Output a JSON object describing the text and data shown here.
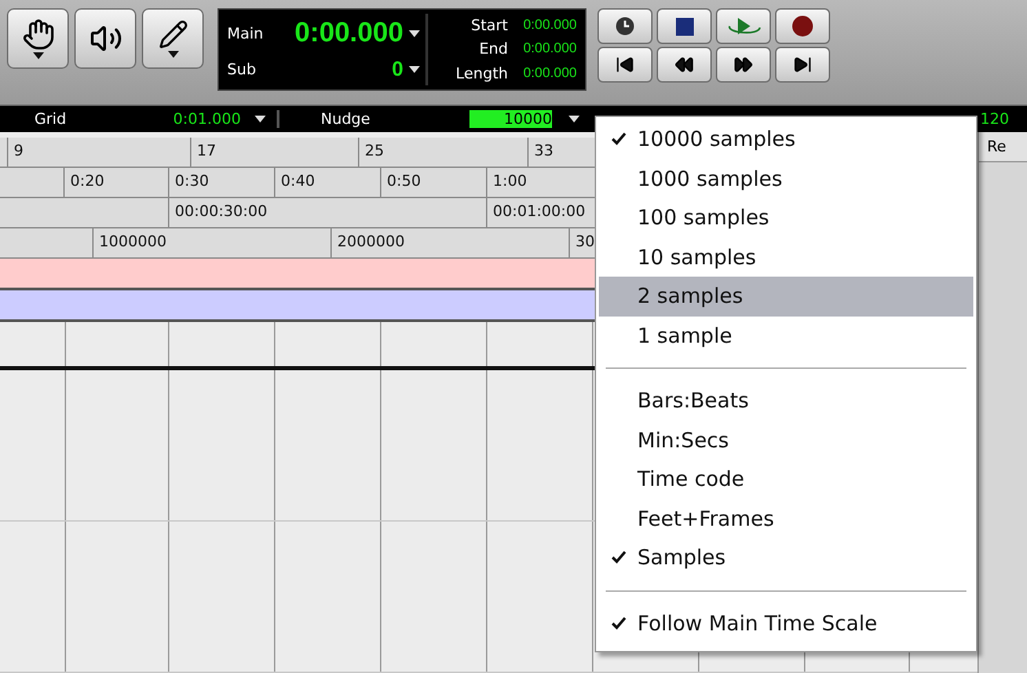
{
  "tools": [
    {
      "kind": "hand",
      "dropdown": true
    },
    {
      "kind": "speaker",
      "dropdown": false
    },
    {
      "kind": "pencil",
      "dropdown": true
    }
  ],
  "time_display": {
    "main": {
      "label": "Main",
      "value": "0:00.000"
    },
    "sub": {
      "label": "Sub",
      "value": "0"
    },
    "selection": [
      {
        "label": "Start",
        "value": "0:00.000"
      },
      {
        "label": "End",
        "value": "0:00.000"
      },
      {
        "label": "Length",
        "value": "0:00.000"
      }
    ]
  },
  "transport": [
    [
      {
        "kind": "clock"
      },
      {
        "kind": "stop"
      },
      {
        "kind": "play-loop"
      },
      {
        "kind": "record"
      }
    ],
    [
      {
        "kind": "to-start"
      },
      {
        "kind": "rewind"
      },
      {
        "kind": "forward"
      },
      {
        "kind": "to-end"
      }
    ]
  ],
  "grid_bar": {
    "grid_label": "Grid",
    "grid_value": "0:01.000",
    "nudge_label": "Nudge",
    "nudge_value": "10000",
    "tempo": "120"
  },
  "rulers": [
    {
      "kind": "bars",
      "marks": [
        "9",
        "17",
        "25",
        "33"
      ]
    },
    {
      "kind": "minsecs",
      "marks": [
        "0:20",
        "0:30",
        "0:40",
        "0:50",
        "1:00"
      ]
    },
    {
      "kind": "timecode",
      "marks": [
        "00:00:30:00",
        "00:01:00:00"
      ]
    },
    {
      "kind": "samples",
      "marks": [
        "1000000",
        "2000000",
        "30"
      ]
    }
  ],
  "tracks": [
    {
      "color": "#ffcccc"
    },
    {
      "color": "#ccccff"
    }
  ],
  "side_column": {
    "header": "Re"
  },
  "menu": {
    "sections": [
      [
        {
          "label": "10000 samples",
          "checked": true,
          "selected": false
        },
        {
          "label": "1000 samples",
          "checked": false,
          "selected": false
        },
        {
          "label": "100 samples",
          "checked": false,
          "selected": false
        },
        {
          "label": "10 samples",
          "checked": false,
          "selected": false
        },
        {
          "label": "2 samples",
          "checked": false,
          "selected": true
        },
        {
          "label": "1 sample",
          "checked": false,
          "selected": false
        }
      ],
      [
        {
          "label": "Bars:Beats",
          "checked": false,
          "selected": false
        },
        {
          "label": "Min:Secs",
          "checked": false,
          "selected": false
        },
        {
          "label": "Time code",
          "checked": false,
          "selected": false
        },
        {
          "label": "Feet+Frames",
          "checked": false,
          "selected": false
        },
        {
          "label": "Samples",
          "checked": true,
          "selected": false
        }
      ],
      [
        {
          "label": "Follow Main Time Scale",
          "checked": true,
          "selected": false
        }
      ]
    ]
  }
}
